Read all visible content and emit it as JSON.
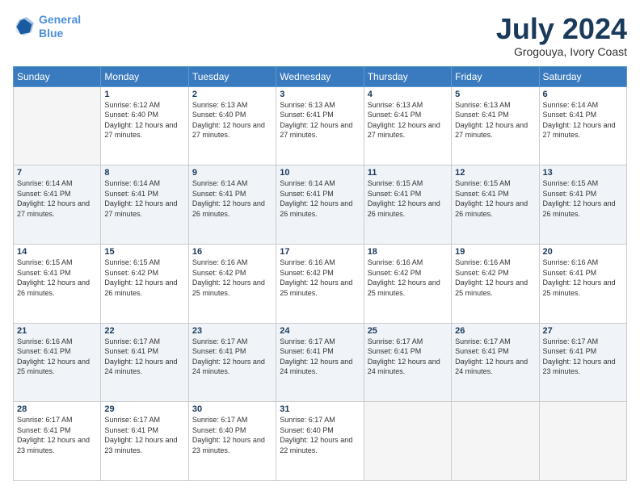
{
  "logo": {
    "line1": "General",
    "line2": "Blue"
  },
  "header": {
    "month": "July 2024",
    "location": "Grogouya, Ivory Coast"
  },
  "weekdays": [
    "Sunday",
    "Monday",
    "Tuesday",
    "Wednesday",
    "Thursday",
    "Friday",
    "Saturday"
  ],
  "weeks": [
    [
      {
        "day": "",
        "sunrise": "",
        "sunset": "",
        "daylight": ""
      },
      {
        "day": "1",
        "sunrise": "Sunrise: 6:12 AM",
        "sunset": "Sunset: 6:40 PM",
        "daylight": "Daylight: 12 hours and 27 minutes."
      },
      {
        "day": "2",
        "sunrise": "Sunrise: 6:13 AM",
        "sunset": "Sunset: 6:40 PM",
        "daylight": "Daylight: 12 hours and 27 minutes."
      },
      {
        "day": "3",
        "sunrise": "Sunrise: 6:13 AM",
        "sunset": "Sunset: 6:41 PM",
        "daylight": "Daylight: 12 hours and 27 minutes."
      },
      {
        "day": "4",
        "sunrise": "Sunrise: 6:13 AM",
        "sunset": "Sunset: 6:41 PM",
        "daylight": "Daylight: 12 hours and 27 minutes."
      },
      {
        "day": "5",
        "sunrise": "Sunrise: 6:13 AM",
        "sunset": "Sunset: 6:41 PM",
        "daylight": "Daylight: 12 hours and 27 minutes."
      },
      {
        "day": "6",
        "sunrise": "Sunrise: 6:14 AM",
        "sunset": "Sunset: 6:41 PM",
        "daylight": "Daylight: 12 hours and 27 minutes."
      }
    ],
    [
      {
        "day": "7",
        "sunrise": "Sunrise: 6:14 AM",
        "sunset": "Sunset: 6:41 PM",
        "daylight": "Daylight: 12 hours and 27 minutes."
      },
      {
        "day": "8",
        "sunrise": "Sunrise: 6:14 AM",
        "sunset": "Sunset: 6:41 PM",
        "daylight": "Daylight: 12 hours and 27 minutes."
      },
      {
        "day": "9",
        "sunrise": "Sunrise: 6:14 AM",
        "sunset": "Sunset: 6:41 PM",
        "daylight": "Daylight: 12 hours and 26 minutes."
      },
      {
        "day": "10",
        "sunrise": "Sunrise: 6:14 AM",
        "sunset": "Sunset: 6:41 PM",
        "daylight": "Daylight: 12 hours and 26 minutes."
      },
      {
        "day": "11",
        "sunrise": "Sunrise: 6:15 AM",
        "sunset": "Sunset: 6:41 PM",
        "daylight": "Daylight: 12 hours and 26 minutes."
      },
      {
        "day": "12",
        "sunrise": "Sunrise: 6:15 AM",
        "sunset": "Sunset: 6:41 PM",
        "daylight": "Daylight: 12 hours and 26 minutes."
      },
      {
        "day": "13",
        "sunrise": "Sunrise: 6:15 AM",
        "sunset": "Sunset: 6:41 PM",
        "daylight": "Daylight: 12 hours and 26 minutes."
      }
    ],
    [
      {
        "day": "14",
        "sunrise": "Sunrise: 6:15 AM",
        "sunset": "Sunset: 6:41 PM",
        "daylight": "Daylight: 12 hours and 26 minutes."
      },
      {
        "day": "15",
        "sunrise": "Sunrise: 6:15 AM",
        "sunset": "Sunset: 6:42 PM",
        "daylight": "Daylight: 12 hours and 26 minutes."
      },
      {
        "day": "16",
        "sunrise": "Sunrise: 6:16 AM",
        "sunset": "Sunset: 6:42 PM",
        "daylight": "Daylight: 12 hours and 25 minutes."
      },
      {
        "day": "17",
        "sunrise": "Sunrise: 6:16 AM",
        "sunset": "Sunset: 6:42 PM",
        "daylight": "Daylight: 12 hours and 25 minutes."
      },
      {
        "day": "18",
        "sunrise": "Sunrise: 6:16 AM",
        "sunset": "Sunset: 6:42 PM",
        "daylight": "Daylight: 12 hours and 25 minutes."
      },
      {
        "day": "19",
        "sunrise": "Sunrise: 6:16 AM",
        "sunset": "Sunset: 6:42 PM",
        "daylight": "Daylight: 12 hours and 25 minutes."
      },
      {
        "day": "20",
        "sunrise": "Sunrise: 6:16 AM",
        "sunset": "Sunset: 6:41 PM",
        "daylight": "Daylight: 12 hours and 25 minutes."
      }
    ],
    [
      {
        "day": "21",
        "sunrise": "Sunrise: 6:16 AM",
        "sunset": "Sunset: 6:41 PM",
        "daylight": "Daylight: 12 hours and 25 minutes."
      },
      {
        "day": "22",
        "sunrise": "Sunrise: 6:17 AM",
        "sunset": "Sunset: 6:41 PM",
        "daylight": "Daylight: 12 hours and 24 minutes."
      },
      {
        "day": "23",
        "sunrise": "Sunrise: 6:17 AM",
        "sunset": "Sunset: 6:41 PM",
        "daylight": "Daylight: 12 hours and 24 minutes."
      },
      {
        "day": "24",
        "sunrise": "Sunrise: 6:17 AM",
        "sunset": "Sunset: 6:41 PM",
        "daylight": "Daylight: 12 hours and 24 minutes."
      },
      {
        "day": "25",
        "sunrise": "Sunrise: 6:17 AM",
        "sunset": "Sunset: 6:41 PM",
        "daylight": "Daylight: 12 hours and 24 minutes."
      },
      {
        "day": "26",
        "sunrise": "Sunrise: 6:17 AM",
        "sunset": "Sunset: 6:41 PM",
        "daylight": "Daylight: 12 hours and 24 minutes."
      },
      {
        "day": "27",
        "sunrise": "Sunrise: 6:17 AM",
        "sunset": "Sunset: 6:41 PM",
        "daylight": "Daylight: 12 hours and 23 minutes."
      }
    ],
    [
      {
        "day": "28",
        "sunrise": "Sunrise: 6:17 AM",
        "sunset": "Sunset: 6:41 PM",
        "daylight": "Daylight: 12 hours and 23 minutes."
      },
      {
        "day": "29",
        "sunrise": "Sunrise: 6:17 AM",
        "sunset": "Sunset: 6:41 PM",
        "daylight": "Daylight: 12 hours and 23 minutes."
      },
      {
        "day": "30",
        "sunrise": "Sunrise: 6:17 AM",
        "sunset": "Sunset: 6:40 PM",
        "daylight": "Daylight: 12 hours and 23 minutes."
      },
      {
        "day": "31",
        "sunrise": "Sunrise: 6:17 AM",
        "sunset": "Sunset: 6:40 PM",
        "daylight": "Daylight: 12 hours and 22 minutes."
      },
      {
        "day": "",
        "sunrise": "",
        "sunset": "",
        "daylight": ""
      },
      {
        "day": "",
        "sunrise": "",
        "sunset": "",
        "daylight": ""
      },
      {
        "day": "",
        "sunrise": "",
        "sunset": "",
        "daylight": ""
      }
    ]
  ]
}
